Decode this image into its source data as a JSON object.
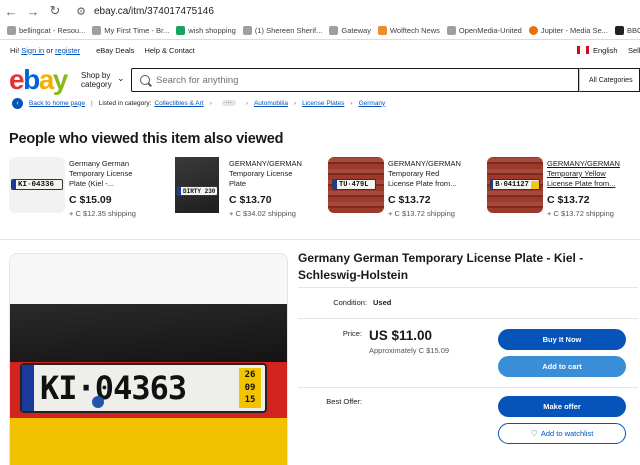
{
  "browser": {
    "url": "ebay.ca/itm/374017475146",
    "nav": {
      "back": "←",
      "forward": "→",
      "reload": "↻"
    },
    "bookmarks": [
      {
        "label": "bellingcat - Resou...",
        "color": "#9aa0a6"
      },
      {
        "label": "My First Time - Br...",
        "color": "#9aa0a6"
      },
      {
        "label": "wish shopping",
        "color": "#1aa260"
      },
      {
        "label": "(1) Shereen Sherif...",
        "color": "#9aa0a6"
      },
      {
        "label": "Gateway",
        "color": "#9aa0a6"
      },
      {
        "label": "Wolftech News",
        "color": "#f28b30"
      },
      {
        "label": "OpenMedia-United",
        "color": "#9aa0a6"
      },
      {
        "label": "Jupiter - Media Se...",
        "color": "#e8710a"
      },
      {
        "label": "BBC",
        "color": "#202124"
      }
    ]
  },
  "topbar": {
    "greeting": "Hi!",
    "sign_in": "Sign in",
    "or": "or",
    "register": "register",
    "deals": "eBay Deals",
    "help": "Help & Contact",
    "language": "English",
    "sell": "Sell"
  },
  "header": {
    "logo": {
      "e": "e",
      "b": "b",
      "a": "a",
      "y": "y"
    },
    "shop_by": "Shop by",
    "category": "category",
    "search_placeholder": "Search for anything",
    "all_categories": "All Categories"
  },
  "breadcrumb": {
    "back_home": "Back to home page",
    "listed_in": "Listed in category:",
    "collectibles": "Collectibles & Art",
    "more": "···",
    "automobilia": "Automobilia",
    "license_plates": "License Plates",
    "germany": "Germany"
  },
  "also_viewed": {
    "title": "People who viewed this item also viewed",
    "items": [
      {
        "title": "Germany German\nTemporary License\nPlate (Kiel -...",
        "price": "C $15.09",
        "shipping": "+ C $12.35 shipping",
        "plate": "KI·04336"
      },
      {
        "title": "GERMANY/GERMAN\nTemporary License\nPlate",
        "price": "C $13.70",
        "shipping": "+ C $34.02 shipping",
        "plate": "DIRTY 230"
      },
      {
        "title": "GERMANY/GERMAN\nTemporary Red\nLicense Plate from...",
        "price": "C $13.72",
        "shipping": "+ C $13.72 shipping",
        "plate": "TU·479L"
      },
      {
        "title": "GERMANY/GERMAN\nTemporary Yellow\nLicense Plate from...",
        "price": "C $13.72",
        "shipping": "+ C $13.72 shipping",
        "plate": "B·041127"
      }
    ]
  },
  "item": {
    "title": "Germany German Temporary License Plate - Kiel - Schleswig-Holstein",
    "plate_text": "KI·04363",
    "plate_date": [
      "26",
      "09",
      "15"
    ],
    "condition_label": "Condition:",
    "condition_value": "Used",
    "price_label": "Price:",
    "price": "US $11.00",
    "approx": "Approximately C $15.09",
    "best_offer_label": "Best Offer:",
    "buy_now": "Buy It Now",
    "add_to_cart": "Add to cart",
    "make_offer": "Make offer",
    "add_watchlist": "Add to watchlist"
  },
  "colors": {
    "ebay_blue": "#0654ba",
    "cart_blue": "#3a8ed8",
    "flag_black": "#1a1a1a",
    "flag_red": "#d2231e",
    "flag_gold": "#f2c200"
  }
}
